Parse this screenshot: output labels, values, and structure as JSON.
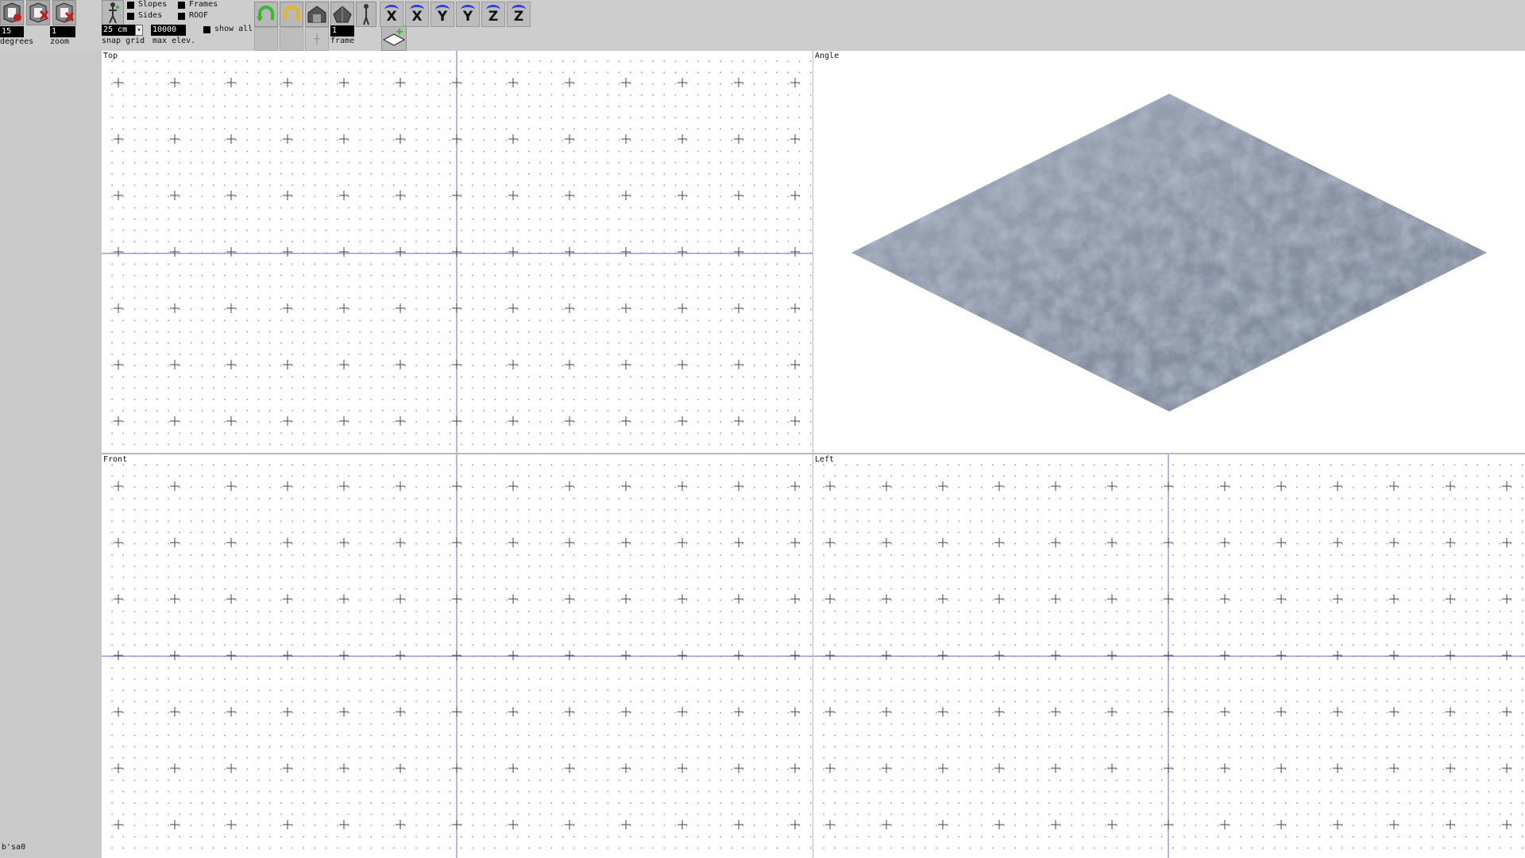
{
  "toolbar": {
    "degrees_value": "15",
    "degrees_label": "degrees",
    "zoom_value": "1",
    "zoom_label": "zoom",
    "snap_grid_value": "25 cm",
    "snap_grid_label": "snap grid",
    "max_elev_value": "10000",
    "max_elev_label": "max elev.",
    "frame_value": "1",
    "frame_label": "frame",
    "checkboxes": {
      "slopes": "Slopes",
      "frames": "Frames",
      "sides": "Sides",
      "roof": "ROOF",
      "show_all": "show all"
    },
    "axis_buttons": [
      "X",
      "X",
      "Y",
      "Y",
      "Z",
      "Z"
    ],
    "icons": {
      "file_1": "map-file-icon",
      "file_2": "map-file-delete-icon",
      "file_3": "map-file-close-icon",
      "person": "person-figure-icon",
      "undo": "undo-arrow-icon",
      "redo": "redo-arrow-icon",
      "house_1": "house-shape-icon",
      "house_2": "house-roof-icon",
      "figure": "stick-figure-icon",
      "tile": "tile-add-icon"
    }
  },
  "viewports": {
    "top": "Top",
    "angle": "Angle",
    "front": "Front",
    "left": "Left"
  },
  "status": "b'sa0",
  "colors": {
    "axis_line": "#7f86d1",
    "plus_mark": "#444444",
    "undo_green": "#39b82f",
    "redo_yellow": "#e0b726",
    "rotate_blue": "#2b3fd6",
    "tile_base": "#8d98a9"
  }
}
